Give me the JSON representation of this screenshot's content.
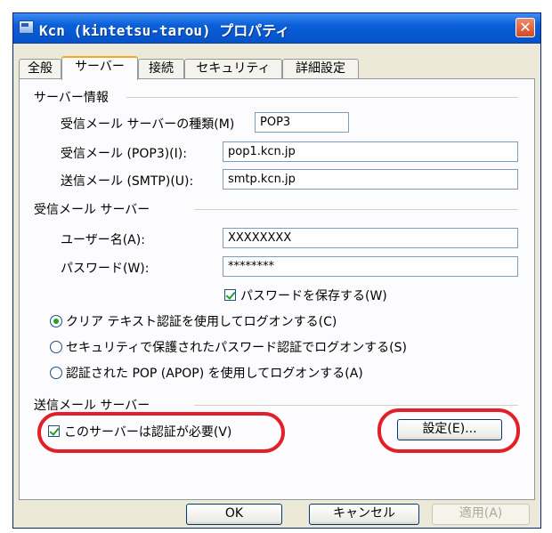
{
  "window": {
    "title": "Kcn (kintetsu-tarou) プロパティ",
    "close_glyph": "✕"
  },
  "tabs": [
    "全般",
    "サーバー",
    "接続",
    "セキュリティ",
    "詳細設定"
  ],
  "server_info": {
    "group_label": "サーバー情報",
    "incoming_type_label": "受信メール サーバーの種類(M)",
    "incoming_type_value": "POP3",
    "incoming_label": "受信メール (POP3)(I):",
    "incoming_value": "pop1.kcn.jp",
    "outgoing_label": "送信メール (SMTP)(U):",
    "outgoing_value": "smtp.kcn.jp"
  },
  "incoming_server": {
    "group_label": "受信メール サーバー",
    "username_label": "ユーザー名(A):",
    "username_value": "XXXXXXXX",
    "password_label": "パスワード(W):",
    "password_value": "********",
    "remember_label": "パスワードを保存する(W)",
    "radio_cleartext": "クリア テキスト認証を使用してログオンする(C)",
    "radio_spa": "セキュリティで保護されたパスワード認証でログオンする(S)",
    "radio_apop": "認証された POP (APOP) を使用してログオンする(A)"
  },
  "outgoing_server": {
    "group_label": "送信メール サーバー",
    "auth_required_label": "このサーバーは認証が必要(V)",
    "settings_button": "設定(E)..."
  },
  "footer": {
    "ok": "OK",
    "cancel": "キャンセル",
    "apply": "適用(A)"
  },
  "colors": {
    "highlight": "#e2202a",
    "titlebar": "#0a5fd8",
    "tab_accent": "#f5a623"
  }
}
